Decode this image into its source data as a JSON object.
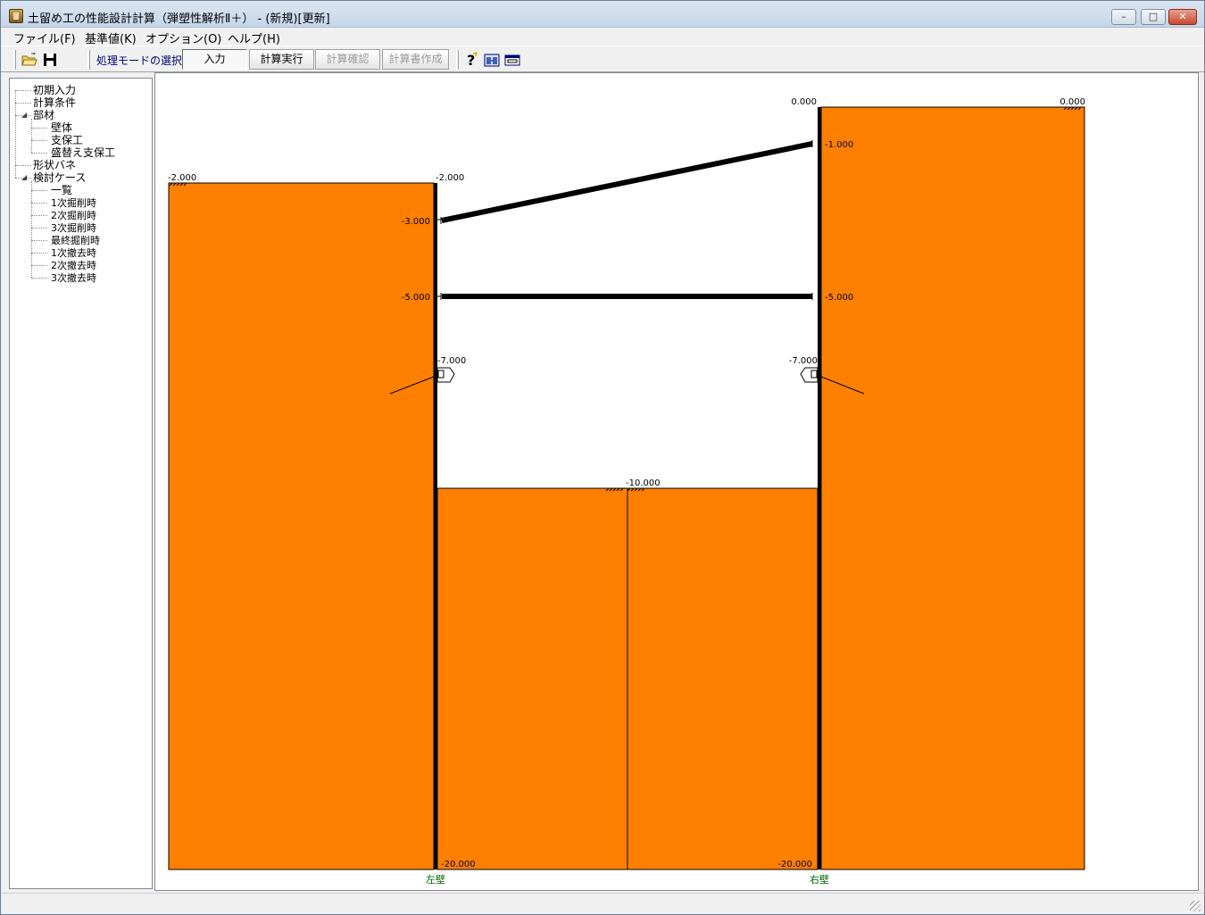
{
  "window": {
    "title": "土留め工の性能設計計算（弾塑性解析Ⅱ＋） - (新規)[更新]",
    "buttons": {
      "minimize": "–",
      "maximize": "□",
      "close": "✕"
    }
  },
  "menu": [
    "ファイル(F)",
    "基準値(K)",
    "オプション(O)",
    "ヘルプ(H)"
  ],
  "toolbar": {
    "mode_label": "処理モードの選択",
    "buttons": [
      {
        "label": "入力",
        "state": "pressed"
      },
      {
        "label": "計算実行",
        "state": "enabled"
      },
      {
        "label": "計算確認",
        "state": "disabled"
      },
      {
        "label": "計算書作成",
        "state": "disabled"
      }
    ],
    "icons": [
      "open-folder-icon",
      "save-icon",
      "help-icon",
      "model-view-icon",
      "window-icon"
    ]
  },
  "tree": {
    "items": [
      {
        "label": "初期入力",
        "level": 0
      },
      {
        "label": "計算条件",
        "level": 0
      },
      {
        "label": "部材",
        "level": 0,
        "expanded": true
      },
      {
        "label": "壁体",
        "level": 1
      },
      {
        "label": "支保工",
        "level": 1
      },
      {
        "label": "盛替え支保工",
        "level": 1
      },
      {
        "label": "形状バネ",
        "level": 0
      },
      {
        "label": "検討ケース",
        "level": 0,
        "expanded": true
      },
      {
        "label": "一覧",
        "level": 1
      },
      {
        "label": "1次掘削時",
        "level": 1
      },
      {
        "label": "2次掘削時",
        "level": 1
      },
      {
        "label": "3次掘削時",
        "level": 1
      },
      {
        "label": "最終掘削時",
        "level": 1
      },
      {
        "label": "1次撤去時",
        "level": 1
      },
      {
        "label": "2次撤去時",
        "level": 1
      },
      {
        "label": "3次撤去時",
        "level": 1
      }
    ]
  },
  "drawing": {
    "colors": {
      "soil": "#ff8000",
      "wall": "#000000",
      "strut": "#000000",
      "wall_label": "#006400"
    },
    "wall_labels": {
      "left": "左壁",
      "right": "右壁"
    },
    "levels": {
      "left_ground": "-2.000",
      "left_wall_top": "-2.000",
      "right_wall_top": "0.000",
      "right_ground": "0.000",
      "strut1_left": "-3.000",
      "strut1_right": "-1.000",
      "strut2_left": "-5.000",
      "strut2_right": "-5.000",
      "anchor_left": "-7.000",
      "anchor_right": "-7.000",
      "excavation_bottom": "-10.000",
      "left_wall_bottom": "-20.000",
      "right_wall_bottom": "-20.000"
    }
  }
}
